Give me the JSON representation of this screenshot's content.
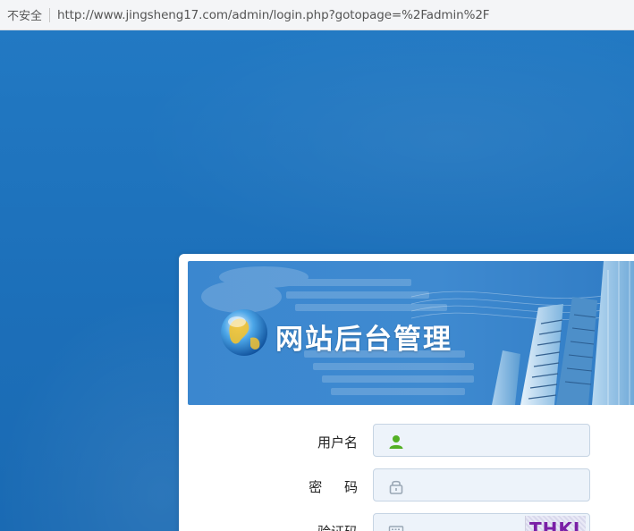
{
  "browser": {
    "security_label": "不安全",
    "url": "http://www.jingsheng17.com/admin/login.php?gotopage=%2Fadmin%2F"
  },
  "banner": {
    "title": "网站后台管理",
    "icon": "globe-icon"
  },
  "form": {
    "username_label": "用户名",
    "username_icon": "user-icon",
    "password_label": "密 码",
    "password_icon": "lock-icon",
    "captcha_label": "验证码",
    "captcha_icon": "keyboard-icon",
    "captcha_text": "THKJ"
  },
  "colors": {
    "background": "#1f72bd",
    "input_bg": "#edf3fa",
    "user_icon": "#53b024",
    "captcha_text": "#7a1fa6"
  }
}
